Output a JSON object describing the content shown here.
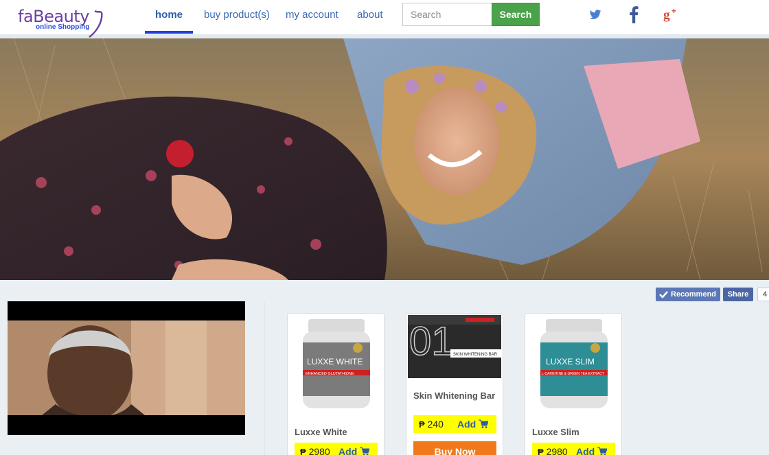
{
  "brand": {
    "name": "faBeauty",
    "tagline": "online Shopping",
    "color": "#6a3fa0"
  },
  "nav": {
    "items": [
      {
        "label": "home",
        "active": true
      },
      {
        "label": "buy product(s)",
        "active": false
      },
      {
        "label": "my account",
        "active": false
      },
      {
        "label": "about",
        "active": false
      }
    ]
  },
  "search": {
    "placeholder": "Search",
    "value": "",
    "button_label": "Search"
  },
  "social": {
    "icons": [
      "twitter-icon",
      "facebook-icon",
      "google-plus-icon"
    ]
  },
  "facebook_bar": {
    "recommend_label": "Recommend",
    "share_label": "Share",
    "count": "4"
  },
  "products": [
    {
      "name": "Luxxe White",
      "price": "2980",
      "add_label": "Add",
      "currency": "₱",
      "label_on_product": "LUXXE WHITE",
      "sublabel_on_product": "ENHANCED GLUTATHIONE"
    },
    {
      "name": "Skin Whitening Bar",
      "price": "240",
      "add_label": "Add",
      "currency": "₱",
      "buy_label": "Buy Now",
      "label_on_product": "01",
      "sublabel_on_product": "SKIN WHITENING BAR"
    },
    {
      "name": "Luxxe Slim",
      "price": "2980",
      "add_label": "Add",
      "currency": "₱",
      "label_on_product": "LUXXE SLIM",
      "sublabel_on_product": "L-CARNITINE & GREEN TEA EXTRACT"
    }
  ],
  "colors": {
    "accent_blue": "#3a67b4",
    "search_green": "#4aa34a",
    "price_yellow": "#ffff00",
    "buy_orange": "#f07a1b"
  }
}
